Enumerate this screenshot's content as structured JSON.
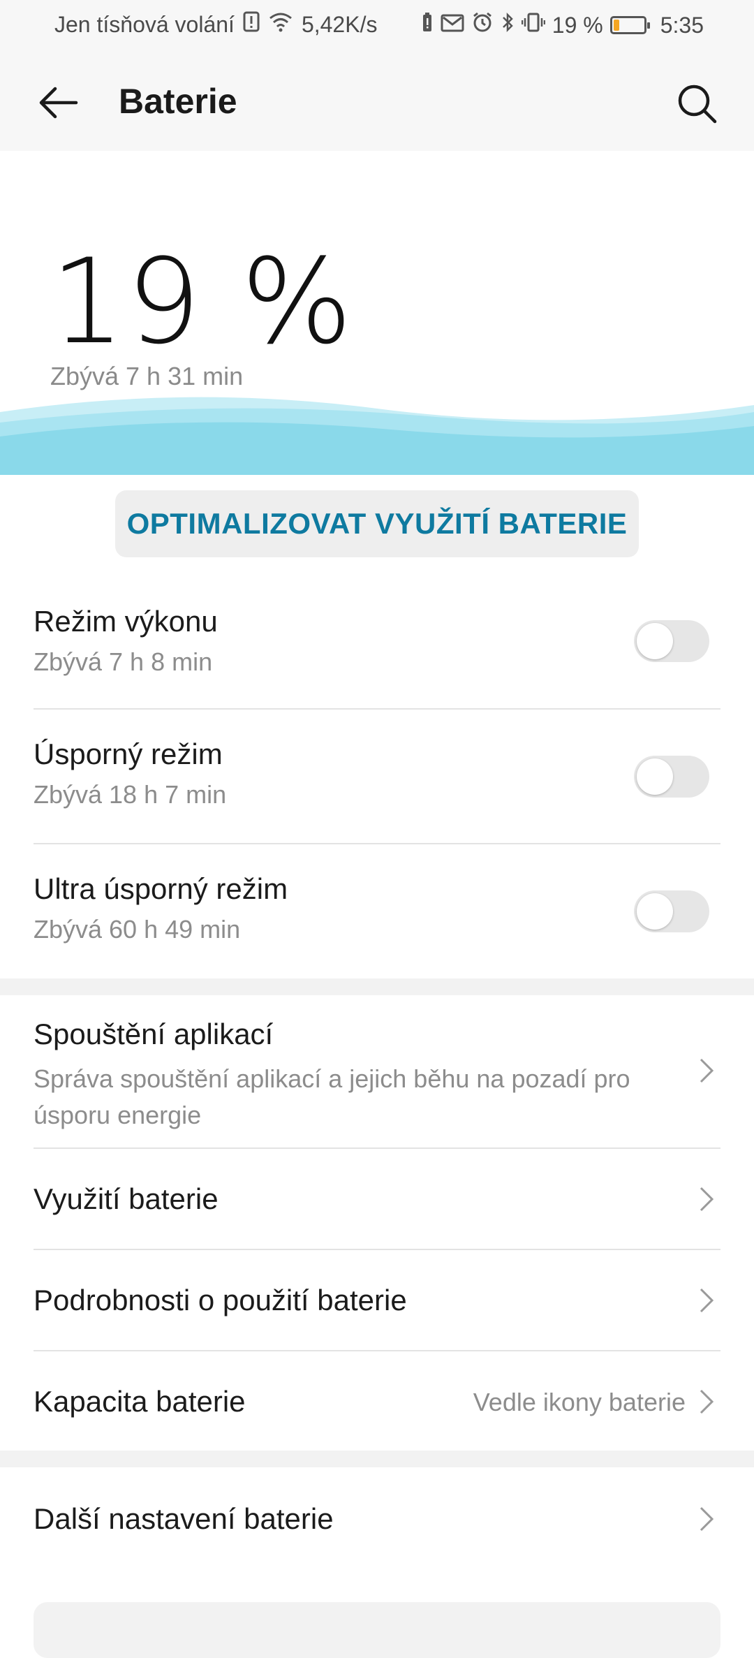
{
  "status_bar": {
    "carrier": "Jen tísňová volání",
    "speed": "5,42K/s",
    "battery_percent_text": "19 %",
    "battery_level": 0.19,
    "time": "5:35"
  },
  "header": {
    "title": "Baterie"
  },
  "hero": {
    "percent": "19 %",
    "remaining": "Zbývá 7 h 31 min"
  },
  "optimize_button": "OPTIMALIZOVAT VYUŽITÍ BATERIE",
  "modes": [
    {
      "title": "Režim výkonu",
      "subtitle": "Zbývá 7 h 8 min",
      "enabled": false
    },
    {
      "title": "Úsporný režim",
      "subtitle": "Zbývá 18 h 7 min",
      "enabled": false
    },
    {
      "title": "Ultra úsporný režim",
      "subtitle": "Zbývá 60 h 49 min",
      "enabled": false
    }
  ],
  "settings": [
    {
      "title": "Spouštění aplikací",
      "subtitle_line1": "Správa spouštění aplikací a jejich běhu na pozadí pro",
      "subtitle_line2": "úsporu energie"
    },
    {
      "title": "Využití baterie"
    },
    {
      "title": "Podrobnosti o použití baterie"
    },
    {
      "title": "Kapacita baterie",
      "value": "Vedle ikony baterie"
    }
  ],
  "more": {
    "title": "Další nastavení baterie"
  },
  "colors": {
    "accent": "#0e7aa0",
    "wave": "#8ad9ea",
    "battery_low": "#f5a623"
  }
}
